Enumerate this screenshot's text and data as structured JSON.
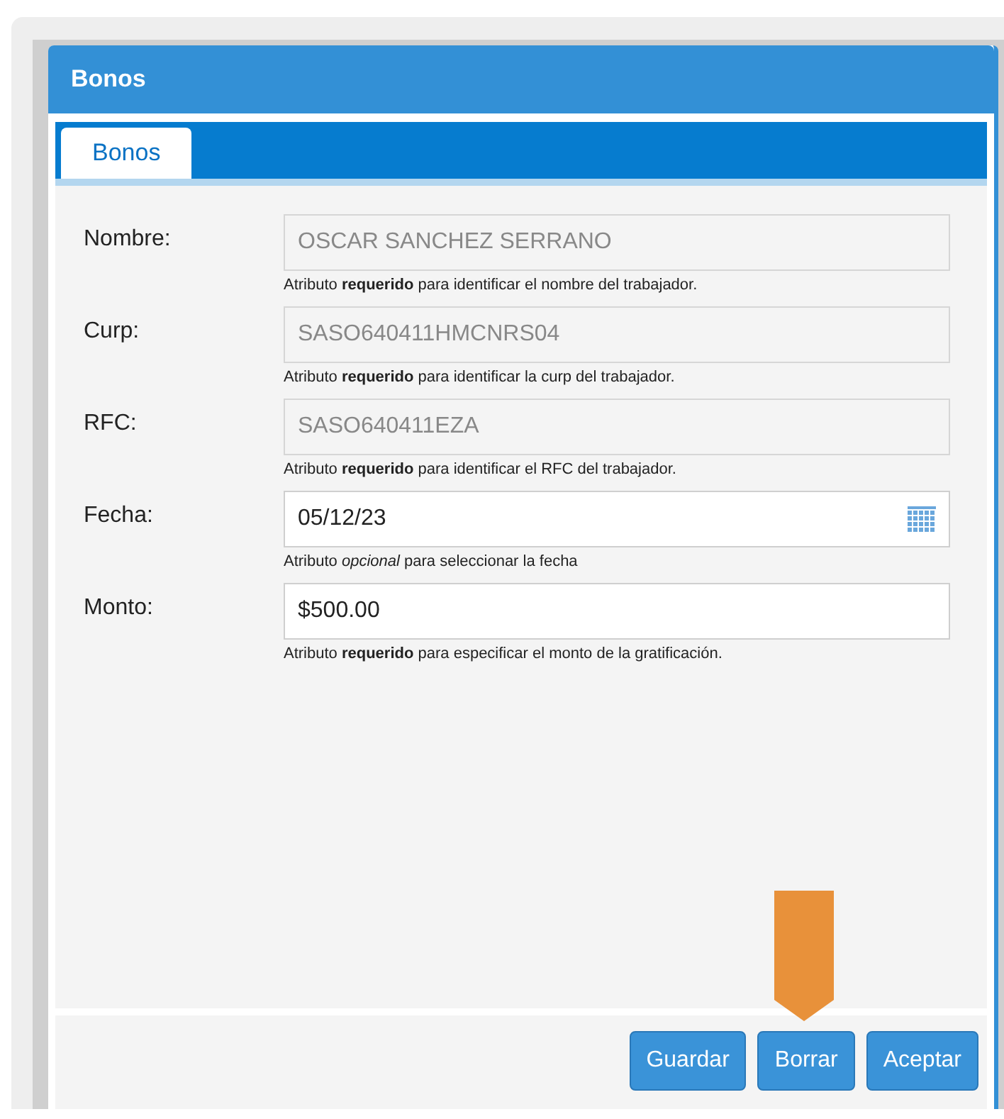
{
  "dialog": {
    "title": "Bonos"
  },
  "tabs": [
    {
      "label": "Bonos",
      "selected": true
    }
  ],
  "fields": [
    {
      "label": "Nombre:",
      "value": "OSCAR SANCHEZ SERRANO",
      "kind": "text",
      "disabled": true,
      "hint": "Atributo **requerido** para identificar el nombre del trabajador."
    },
    {
      "label": "Curp:",
      "value": "SASO640411HMCNRS04",
      "kind": "text",
      "disabled": true,
      "hint": "Atributo **requerido** para identificar la curp del trabajador."
    },
    {
      "label": "RFC:",
      "value": "SASO640411EZA",
      "kind": "text",
      "disabled": true,
      "hint": "Atributo **requerido** para identificar el RFC del trabajador."
    },
    {
      "label": "Fecha:",
      "value": "05/12/23",
      "kind": "date",
      "disabled": false,
      "hint": "Atributo *opcional* para seleccionar la fecha"
    },
    {
      "label": "Monto:",
      "value": "$500.00",
      "kind": "text",
      "disabled": false,
      "hint": "Atributo **requerido** para especificar el monto de la gratificación."
    }
  ],
  "buttons": [
    "Guardar",
    "Borrar",
    "Aceptar"
  ]
}
